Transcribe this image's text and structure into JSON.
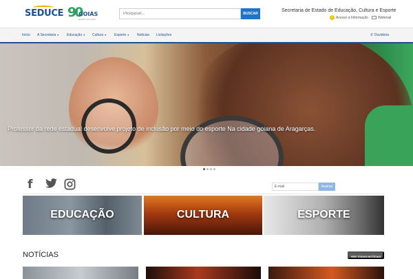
{
  "header": {
    "logo_seduce": "SEDUCE",
    "logo_goias": "GOIÁS",
    "logo_goias_mark": "90",
    "logo_goias_sub": "governo com você",
    "search_placeholder": "Pesquisar...",
    "search_button": "BUSCAR",
    "secretaria": "Secretaria de Estado de Educação, Cultura e Esporte",
    "acesso_informacao": "Acesso à Informação",
    "webmail": "Webmail"
  },
  "nav": {
    "items": [
      {
        "label": "Início",
        "caret": ""
      },
      {
        "label": "A Secretaria",
        "caret": "▾"
      },
      {
        "label": "Educação",
        "caret": "▾"
      },
      {
        "label": "Cultura",
        "caret": "▾"
      },
      {
        "label": "Esporte",
        "caret": "▾"
      },
      {
        "label": "Notícias",
        "caret": ""
      },
      {
        "label": "Licitações",
        "caret": ""
      }
    ],
    "ouvidoria": "Ouvidoria"
  },
  "hero": {
    "caption": "Professor da rede estadual desenvolve projeto de inclusão por meio do esporte Na cidade goiana de Aragarças.",
    "slides": 4,
    "active_slide": 1
  },
  "social": {
    "icons": [
      "facebook-icon",
      "twitter-icon",
      "instagram-icon"
    ]
  },
  "newsletter": {
    "email_value": "E-mail",
    "button": "Assinar"
  },
  "categories": [
    {
      "label": "EDUCAÇÃO"
    },
    {
      "label": "CULTURA"
    },
    {
      "label": "ESPORTE"
    }
  ],
  "news": {
    "title": "NOTÍCIAS",
    "ver_todas": "VER TODAS NOTÍCIAS"
  },
  "colors": {
    "brand_blue": "#1d4f91",
    "button_blue": "#1f73c8",
    "brand_green": "#2ca25f",
    "brand_yellow": "#f2c200"
  }
}
